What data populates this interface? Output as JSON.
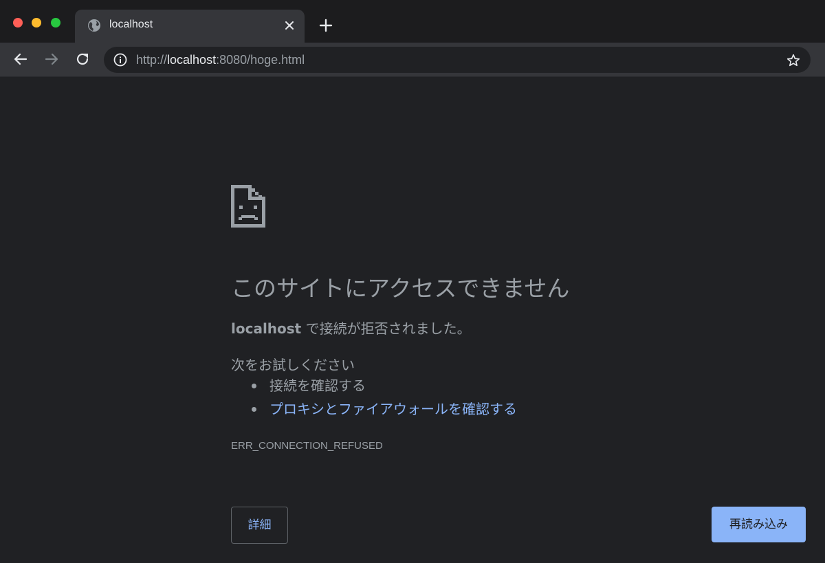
{
  "tab": {
    "title": "localhost",
    "globe_icon": "globe-icon",
    "close_icon": "close-icon"
  },
  "toolbar": {
    "url_prefix": "http://",
    "url_host": "localhost",
    "url_suffix": ":8080/hoge.html",
    "back_icon": "arrow-left-icon",
    "forward_icon": "arrow-right-icon",
    "reload_icon": "reload-icon",
    "info_icon": "info-icon",
    "bookmark_icon": "star-icon"
  },
  "error": {
    "icon": "sad-document-icon",
    "heading": "このサイトにアクセスできません",
    "host": "localhost",
    "message": " で接続が拒否されました。",
    "try_label": "次をお試しください",
    "suggestions": [
      "接続を確認する",
      "プロキシとファイアウォールを確認する"
    ],
    "code": "ERR_CONNECTION_REFUSED",
    "details_label": "詳細",
    "reload_label": "再読み込み"
  },
  "colors": {
    "background": "#202124",
    "toolbar": "#35363a",
    "text": "#9aa0a6",
    "link": "#8ab4f8",
    "primary_button": "#8ab4f8"
  }
}
